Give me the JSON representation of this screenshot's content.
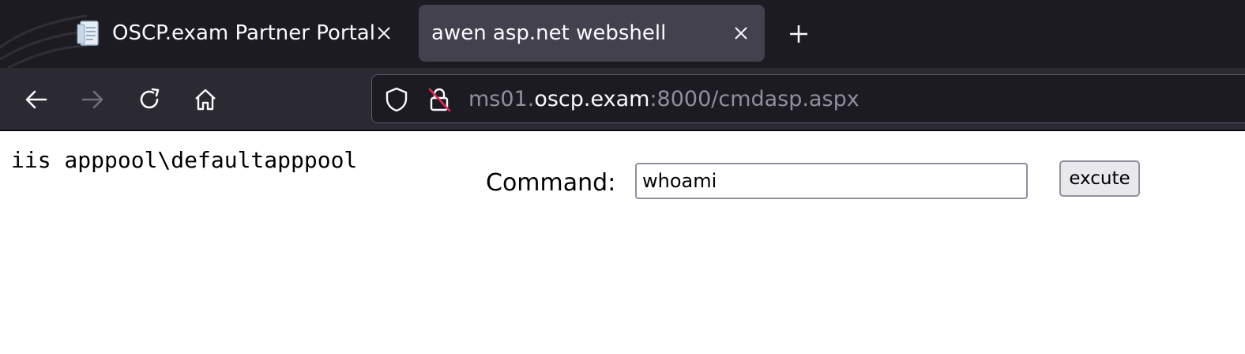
{
  "browser": {
    "tabs": [
      {
        "title": "OSCP.exam Partner Portal",
        "favicon": "document-icon",
        "active": false
      },
      {
        "title": "awen asp.net webshell",
        "active": true
      }
    ],
    "new_tab_icon": "plus-icon",
    "nav": {
      "back_icon": "arrow-left-icon",
      "forward_icon": "arrow-right-icon",
      "reload_icon": "reload-icon",
      "home_icon": "home-icon"
    },
    "urlbar": {
      "url_prefix": "ms01.",
      "url_host": "oscp.exam",
      "url_suffix": ":8000/cmdasp.aspx",
      "shield_icon": "shield-icon",
      "insecure_lock_icon": "lock-insecure-icon"
    },
    "colors": {
      "tabstrip_bg": "#1c1b22",
      "toolbar_bg": "#2b2a33",
      "active_tab_bg": "#42414d",
      "insecure_strike": "#e22850"
    }
  },
  "page": {
    "output": "iis apppool\\defaultapppool",
    "command_label": "Command:",
    "command_value": "whoami",
    "execute_label": "excute"
  }
}
